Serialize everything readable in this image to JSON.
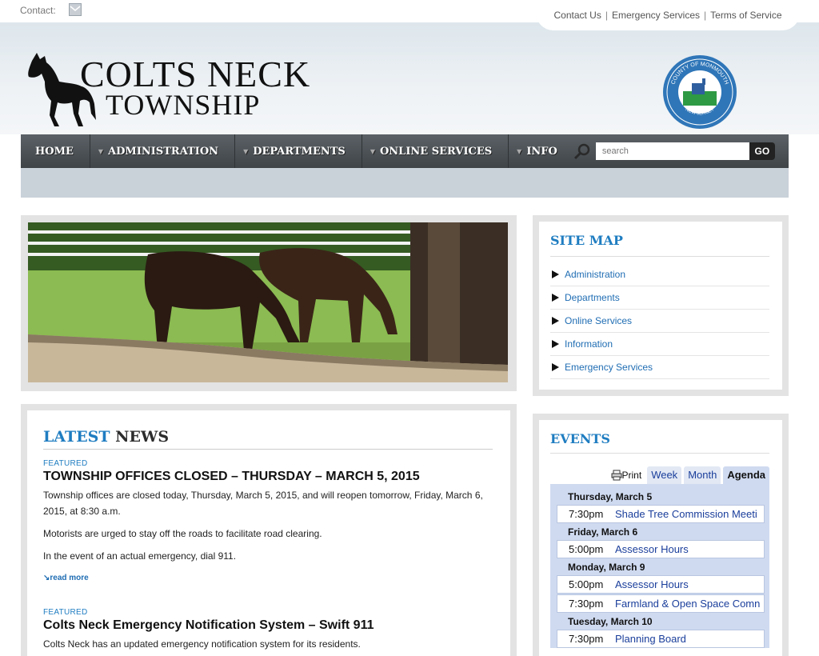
{
  "topbar": {
    "contact_label": "Contact:",
    "links": [
      "Contact Us",
      "Emergency Services",
      "Terms of Service"
    ]
  },
  "logo": {
    "line1": "COLTS NECK",
    "line2": "TOWNSHIP"
  },
  "seal": {
    "top_text": "COUNTY OF MONMOUTH",
    "bottom_text": "NEW JERSEY"
  },
  "nav": {
    "items": [
      "HOME",
      "ADMINISTRATION",
      "DEPARTMENTS",
      "ONLINE SERVICES",
      "INFO"
    ],
    "search_placeholder": "search",
    "go_label": "GO"
  },
  "sitemap": {
    "title": "SITE MAP",
    "items": [
      "Administration",
      "Departments",
      "Online Services",
      "Information",
      "Emergency Services"
    ]
  },
  "news": {
    "title_a": "LATEST",
    "title_b": "NEWS",
    "articles": [
      {
        "tag": "FEATURED",
        "headline": "TOWNSHIP OFFICES CLOSED – THURSDAY – MARCH 5, 2015",
        "paragraphs": [
          "Township offices are closed today, Thursday, March 5, 2015, and will reopen tomorrow, Friday, March 6, 2015, at 8:30 a.m.",
          "Motorists are urged to stay off the roads to facilitate road clearing.",
          "In the event of an actual emergency, dial 911."
        ],
        "read_more": "read more"
      },
      {
        "tag": "FEATURED",
        "headline": "Colts Neck Emergency Notification System – Swift 911",
        "paragraphs": [
          "Colts Neck has an updated emergency notification system for its residents."
        ]
      }
    ]
  },
  "events": {
    "title": "EVENTS",
    "print_label": "Print",
    "tabs": [
      "Week",
      "Month",
      "Agenda"
    ],
    "days": [
      {
        "label": "Thursday, March 5",
        "items": [
          {
            "time": "7:30pm",
            "name": "Shade Tree Commission Meeti"
          }
        ]
      },
      {
        "label": "Friday, March 6",
        "items": [
          {
            "time": "5:00pm",
            "name": "Assessor Hours"
          }
        ]
      },
      {
        "label": "Monday, March 9",
        "items": [
          {
            "time": "5:00pm",
            "name": "Assessor Hours"
          },
          {
            "time": "7:30pm",
            "name": "Farmland & Open Space Comn"
          }
        ]
      },
      {
        "label": "Tuesday, March 10",
        "items": [
          {
            "time": "7:30pm",
            "name": "Planning Board"
          }
        ]
      }
    ]
  },
  "colors": {
    "accent": "#1f7dc1",
    "nav_bg": "#4a4f53",
    "link": "#1f6db3"
  }
}
